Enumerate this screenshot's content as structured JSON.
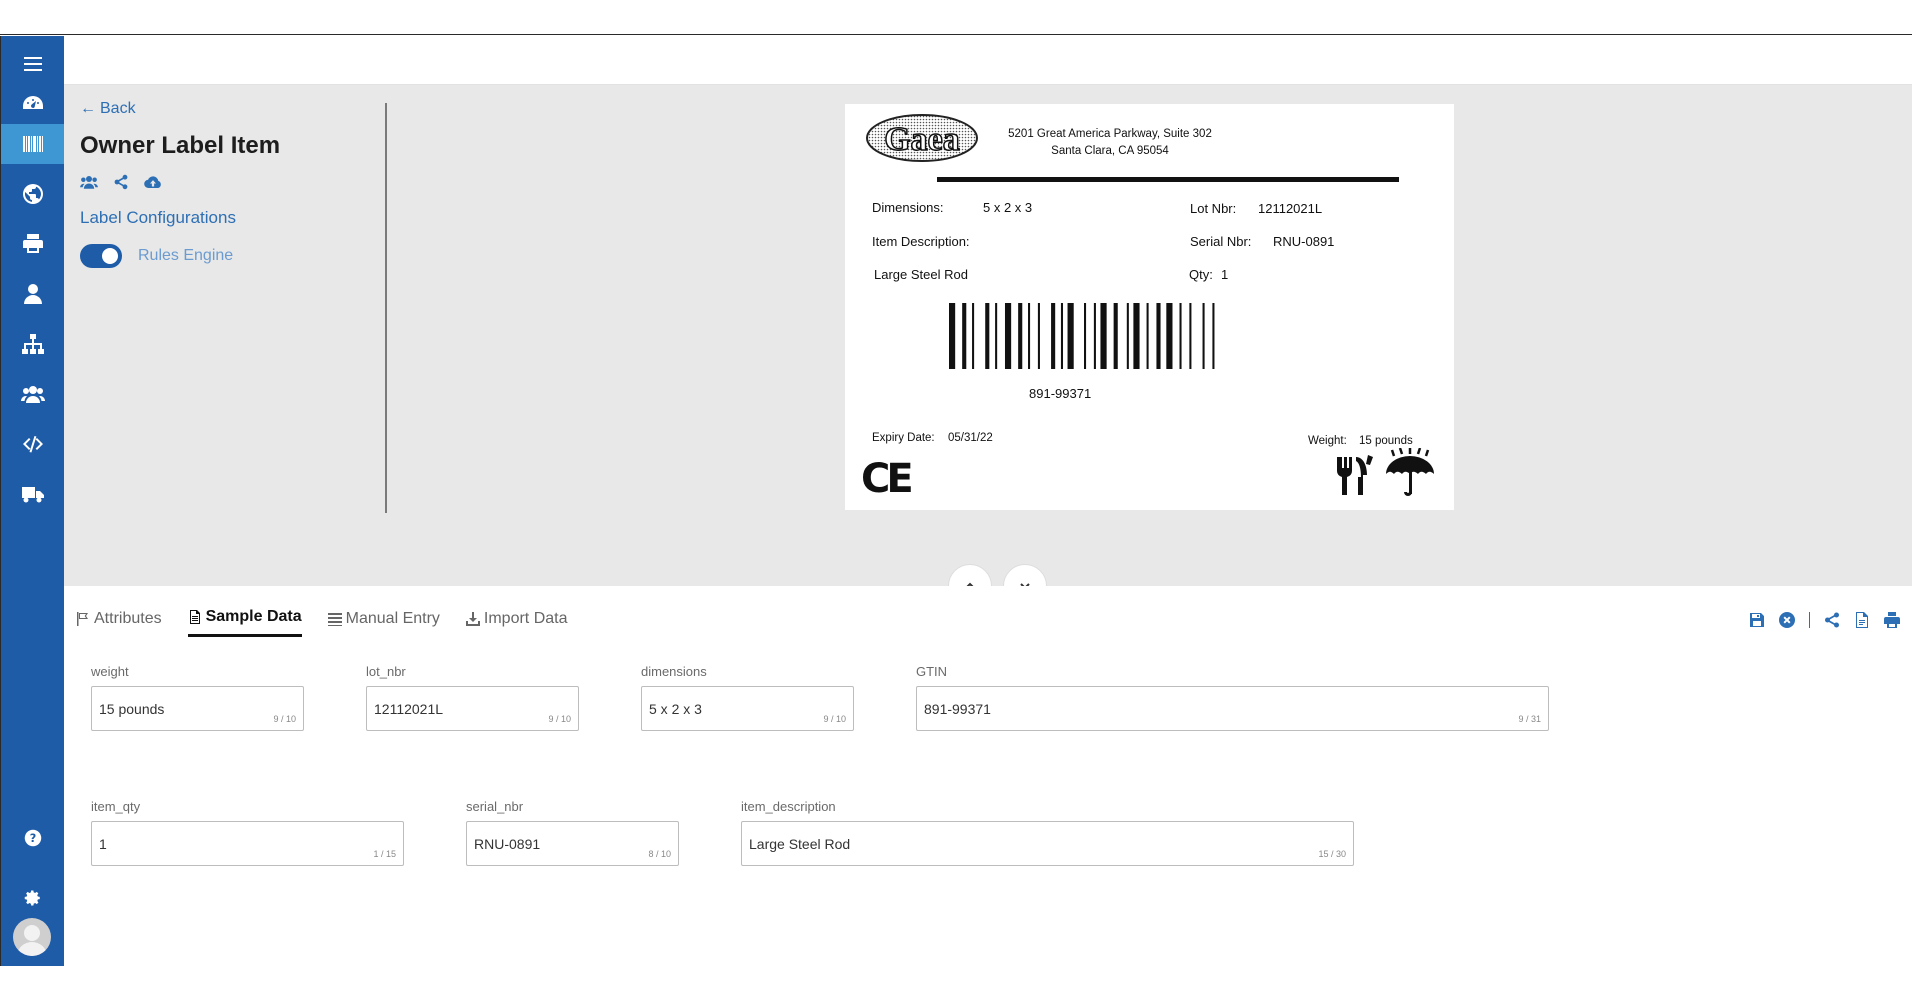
{
  "page": {
    "back_label": "Back",
    "title": "Owner Label Item",
    "config_link": "Label Configurations",
    "rules_engine_label": "Rules Engine"
  },
  "label": {
    "logo_text": "Gaea",
    "address_line1": "5201 Great America Parkway, Suite 302",
    "address_line2": "Santa Clara, CA 95054",
    "dimensions_label": "Dimensions:",
    "dimensions_value": "5 x 2 x 3",
    "lot_label": "Lot Nbr:",
    "lot_value": "12112021L",
    "item_desc_label": "Item Description:",
    "serial_label": "Serial Nbr:",
    "serial_value": "RNU-0891",
    "item_desc_value": "Large Steel Rod",
    "qty_label": "Qty:",
    "qty_value": "1",
    "barcode_text": "891-99371",
    "expiry_label": "Expiry Date:",
    "expiry_value": "05/31/22",
    "weight_label": "Weight:",
    "weight_value": "15 pounds",
    "ce_mark": "CE"
  },
  "tabs": {
    "attributes": "Attributes",
    "sample_data": "Sample Data",
    "manual_entry": "Manual Entry",
    "import_data": "Import Data"
  },
  "fields": {
    "weight": {
      "label": "weight",
      "value": "15 pounds",
      "count": "9 / 10"
    },
    "lot_nbr": {
      "label": "lot_nbr",
      "value": "12112021L",
      "count": "9 / 10"
    },
    "dimensions": {
      "label": "dimensions",
      "value": "5 x 2 x 3",
      "count": "9 / 10"
    },
    "gtin": {
      "label": "GTIN",
      "value": "891-99371",
      "count": "9 / 31"
    },
    "item_qty": {
      "label": "item_qty",
      "value": "1",
      "count": "1 / 15"
    },
    "serial_nbr": {
      "label": "serial_nbr",
      "value": "RNU-0891",
      "count": "8 / 10"
    },
    "item_description": {
      "label": "item_description",
      "value": "Large Steel Rod",
      "count": "15 / 30"
    }
  },
  "colors": {
    "sidebar": "#1f5ca8",
    "sidebar_active": "#3e96d2",
    "accent": "#2d6fb5",
    "editor_bg": "#e8e8e8"
  },
  "icons": {
    "sidebar": [
      "menu-icon",
      "dashboard-icon",
      "barcode-icon",
      "globe-icon",
      "printer-icon",
      "user-icon",
      "sitemap-icon",
      "users-icon",
      "code-icon",
      "truck-icon",
      "help-icon",
      "settings-icon"
    ],
    "title_actions": [
      "users-icon",
      "share-icon",
      "cloud-upload-icon"
    ],
    "right_tools": [
      "save-icon",
      "close-circle-icon",
      "share-icon",
      "pdf-icon",
      "print-icon"
    ]
  }
}
